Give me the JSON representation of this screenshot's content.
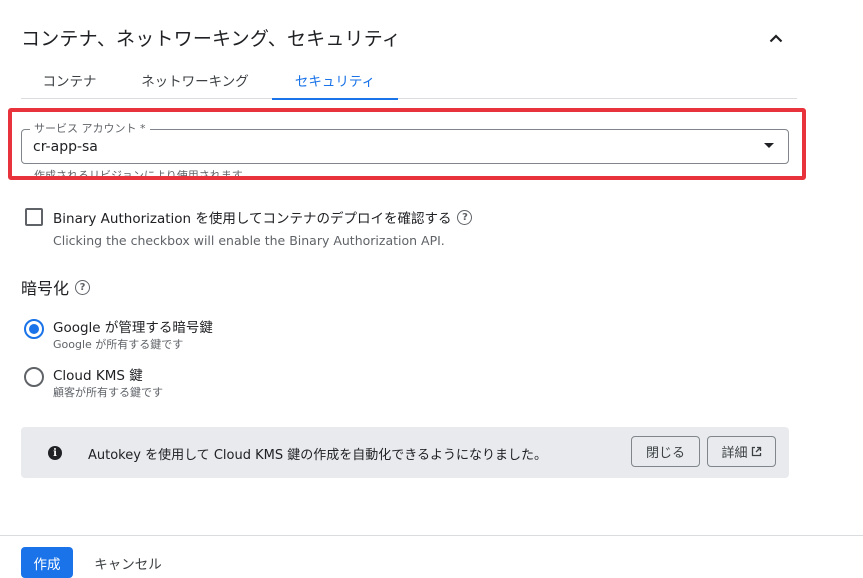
{
  "section": {
    "title": "コンテナ、ネットワーキング、セキュリティ",
    "collapse_icon": "chevron-up-icon"
  },
  "tabs": [
    {
      "label": "コンテナ",
      "active": false
    },
    {
      "label": "ネットワーキング",
      "active": false
    },
    {
      "label": "セキュリティ",
      "active": true
    }
  ],
  "service_account": {
    "label": "サービス アカウント *",
    "value": "cr-app-sa",
    "hint": "作成されるリビジョンにより使用されます。"
  },
  "binary_auth": {
    "label": "Binary Authorization を使用してコンテナのデプロイを確認する",
    "description": "Clicking the checkbox will enable the Binary Authorization API.",
    "checked": false
  },
  "encryption": {
    "title": "暗号化",
    "options": [
      {
        "label": "Google が管理する暗号鍵",
        "sub": "Google が所有する鍵です",
        "selected": true
      },
      {
        "label": "Cloud KMS 鍵",
        "sub": "顧客が所有する鍵です",
        "selected": false
      }
    ]
  },
  "banner": {
    "text": "Autokey を使用して Cloud KMS 鍵の作成を自動化できるようになりました。",
    "close_label": "閉じる",
    "detail_label": "詳細"
  },
  "footer": {
    "create_label": "作成",
    "cancel_label": "キャンセル"
  },
  "colors": {
    "accent": "#1a73e8",
    "highlight": "#e8333c",
    "banner_bg": "#e8eaed"
  }
}
